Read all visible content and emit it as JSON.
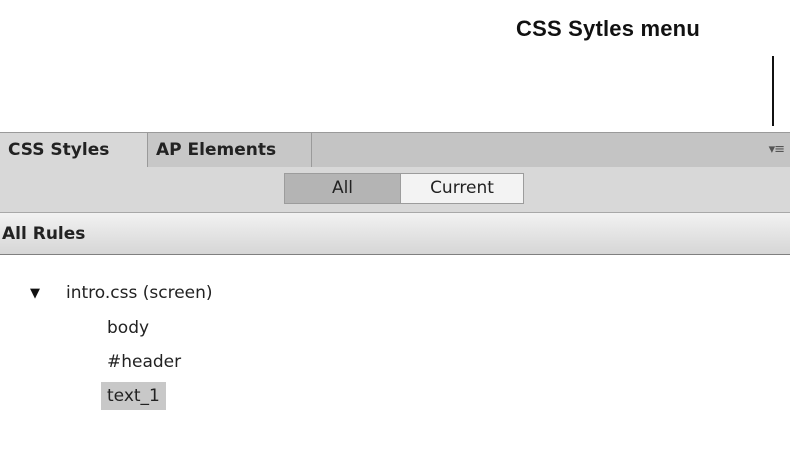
{
  "callout": {
    "label": "CSS Sytles menu"
  },
  "panel": {
    "tabs": [
      {
        "label": "CSS Styles",
        "active": true
      },
      {
        "label": "AP Elements",
        "active": false
      }
    ],
    "menu_icon": "panel-options-menu-icon",
    "toggle": {
      "all_label": "All",
      "current_label": "Current",
      "selected": "All"
    },
    "section_title": "All Rules",
    "tree": {
      "stylesheet": "intro.css (screen)",
      "expanded": true,
      "rules": [
        "body",
        "#header",
        "text_1"
      ],
      "selected_rule": "text_1"
    }
  },
  "colors": {
    "tabbar_bg": "#c4c4c4",
    "active_tab_bg": "#d8d8d8",
    "selected_row_bg": "#c8c8c8",
    "toggle_selected_bg": "#b4b4b4"
  }
}
